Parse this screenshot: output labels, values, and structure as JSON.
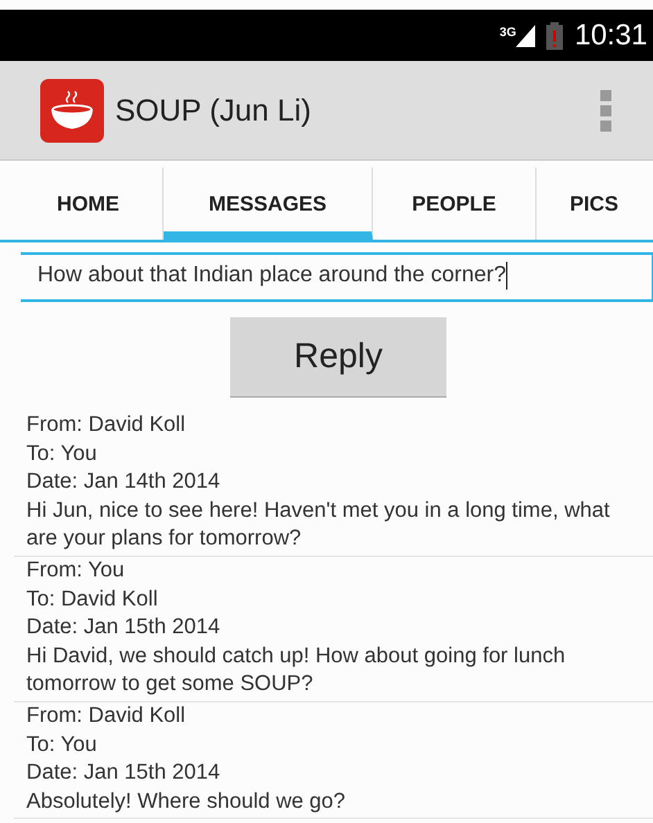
{
  "status_bar": {
    "network": "3G",
    "time": "10:31"
  },
  "action_bar": {
    "title": "SOUP (Jun Li)"
  },
  "tabs": [
    {
      "label": "HOME",
      "selected": false
    },
    {
      "label": "MESSAGES",
      "selected": true
    },
    {
      "label": "PEOPLE",
      "selected": false
    },
    {
      "label": "PICS",
      "selected": false
    }
  ],
  "reply_field": {
    "value": "How about that Indian place around the corner?"
  },
  "reply_button": "Reply",
  "messages": [
    {
      "from": "From: David Koll",
      "to": "To: You",
      "date": "Date: Jan 14th 2014",
      "body": "Hi Jun, nice to see here! Haven't met you in a long time, what are your plans for tomorrow?"
    },
    {
      "from": "From: You",
      "to": "To: David Koll",
      "date": "Date: Jan 15th 2014",
      "body": "Hi David, we should catch up! How about going for lunch tomorrow to get some SOUP?"
    },
    {
      "from": "From: David Koll",
      "to": "To: You",
      "date": "Date: Jan 15th 2014",
      "body": "Absolutely! Where should we go?"
    }
  ]
}
